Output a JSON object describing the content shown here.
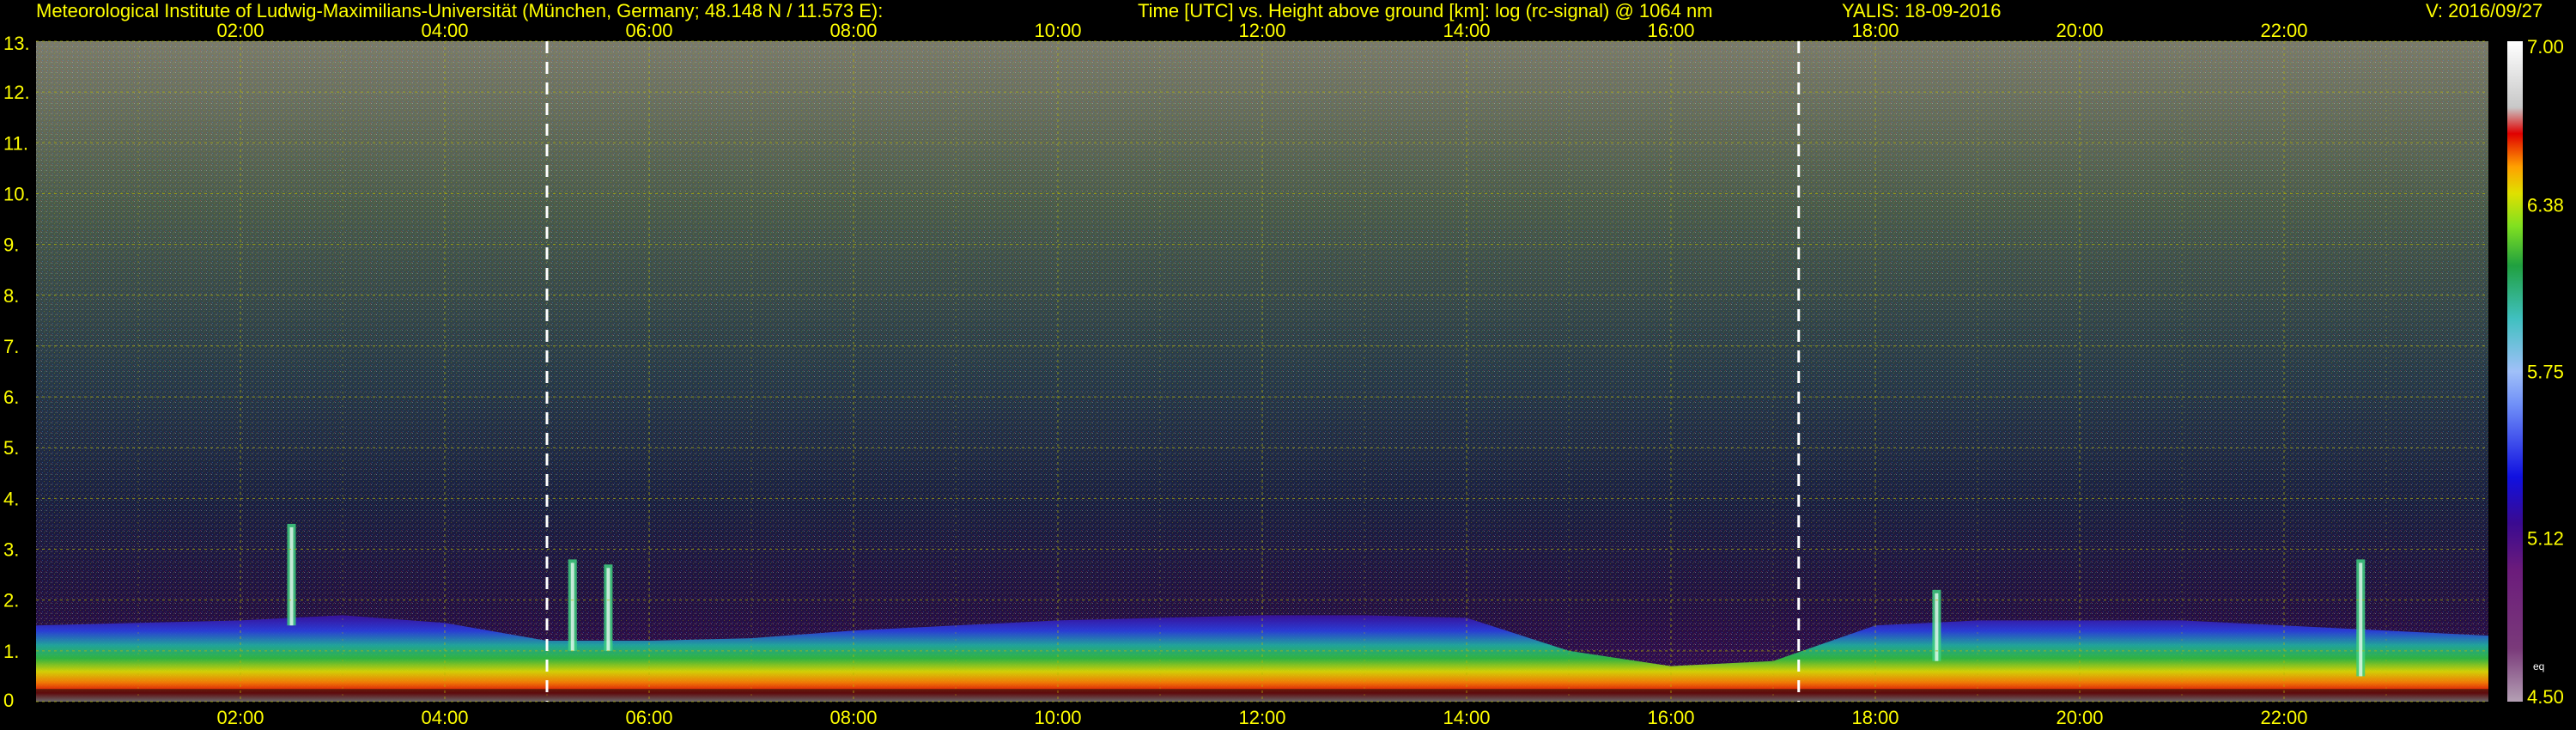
{
  "header": {
    "institute": "Meteorological Institute of Ludwig-Maximilians-Universität (München, Germany; 48.148 N / 11.573 E):",
    "axis_description": "Time [UTC] vs. Height above ground [km]: log (rc-signal) @ 1064 nm",
    "station_date": "YALIS: 18-09-2016",
    "version": "V: 2016/09/27"
  },
  "colors": {
    "header_text": "#ffff00",
    "axis_text": "#ffff00",
    "grid": "#b8b800",
    "background": "#000000",
    "dashed_marker": "#ffffff"
  },
  "chart_data": {
    "type": "heatmap",
    "title": "Time [UTC] vs. Height above ground [km]: log (rc-signal) @ 1064 nm",
    "xlabel": "Time [UTC]",
    "ylabel": "Height above ground [km]",
    "xlim_hours": [
      0,
      24
    ],
    "ylim_km": [
      0,
      13
    ],
    "x_ticks": [
      "02:00",
      "04:00",
      "06:00",
      "08:00",
      "10:00",
      "12:00",
      "14:00",
      "16:00",
      "18:00",
      "20:00",
      "22:00"
    ],
    "x_tick_hours": [
      2,
      4,
      6,
      8,
      10,
      12,
      14,
      16,
      18,
      20,
      22
    ],
    "y_ticks": [
      "0",
      "1.",
      "2.",
      "3.",
      "4.",
      "5.",
      "6.",
      "7.",
      "8.",
      "9.",
      "10.",
      "11.",
      "12.",
      "13."
    ],
    "y_tick_values": [
      0,
      1,
      2,
      3,
      4,
      5,
      6,
      7,
      8,
      9,
      10,
      11,
      12,
      13
    ],
    "grid": true,
    "vertical_markers_hours": [
      5.0,
      17.25
    ],
    "colorbar": {
      "range": [
        4.5,
        7.0
      ],
      "labels": [
        "7.00",
        "6.38",
        "5.75",
        "5.12",
        "4.50"
      ],
      "label_values": [
        7.0,
        6.38,
        5.75,
        5.12,
        4.5
      ],
      "small_label": "eq",
      "colors": [
        "#b4a0b4",
        "#7a3a7a",
        "#6b1b7b",
        "#4b0a8a",
        "#2a0aa0",
        "#1010e0",
        "#4060f0",
        "#7090f8",
        "#a0c0f8",
        "#40c0c0",
        "#30a060",
        "#20c040",
        "#80e020",
        "#e0e000",
        "#ffa000",
        "#ff5000",
        "#e00000",
        "#c8c8c8",
        "#ffffff"
      ]
    },
    "boundary_layer_top_km": [
      [
        0.0,
        1.5
      ],
      [
        1.0,
        1.55
      ],
      [
        2.0,
        1.6
      ],
      [
        3.0,
        1.7
      ],
      [
        4.0,
        1.55
      ],
      [
        5.0,
        1.2
      ],
      [
        6.0,
        1.2
      ],
      [
        7.0,
        1.25
      ],
      [
        8.0,
        1.4
      ],
      [
        9.0,
        1.5
      ],
      [
        10.0,
        1.6
      ],
      [
        11.0,
        1.65
      ],
      [
        12.0,
        1.7
      ],
      [
        13.0,
        1.7
      ],
      [
        14.0,
        1.65
      ],
      [
        15.0,
        1.0
      ],
      [
        16.0,
        0.7
      ],
      [
        17.0,
        0.8
      ],
      [
        18.0,
        1.5
      ],
      [
        19.0,
        1.6
      ],
      [
        20.0,
        1.6
      ],
      [
        21.0,
        1.6
      ],
      [
        22.0,
        1.5
      ],
      [
        23.0,
        1.4
      ],
      [
        24.0,
        1.3
      ]
    ],
    "cloud_features": [
      {
        "hour": 2.5,
        "base_km": 1.5,
        "top_km": 3.5
      },
      {
        "hour": 5.25,
        "base_km": 1.0,
        "top_km": 2.8
      },
      {
        "hour": 5.6,
        "base_km": 1.0,
        "top_km": 2.7
      },
      {
        "hour": 18.6,
        "base_km": 0.8,
        "top_km": 2.2
      },
      {
        "hour": 22.75,
        "base_km": 0.5,
        "top_km": 2.8
      }
    ]
  }
}
